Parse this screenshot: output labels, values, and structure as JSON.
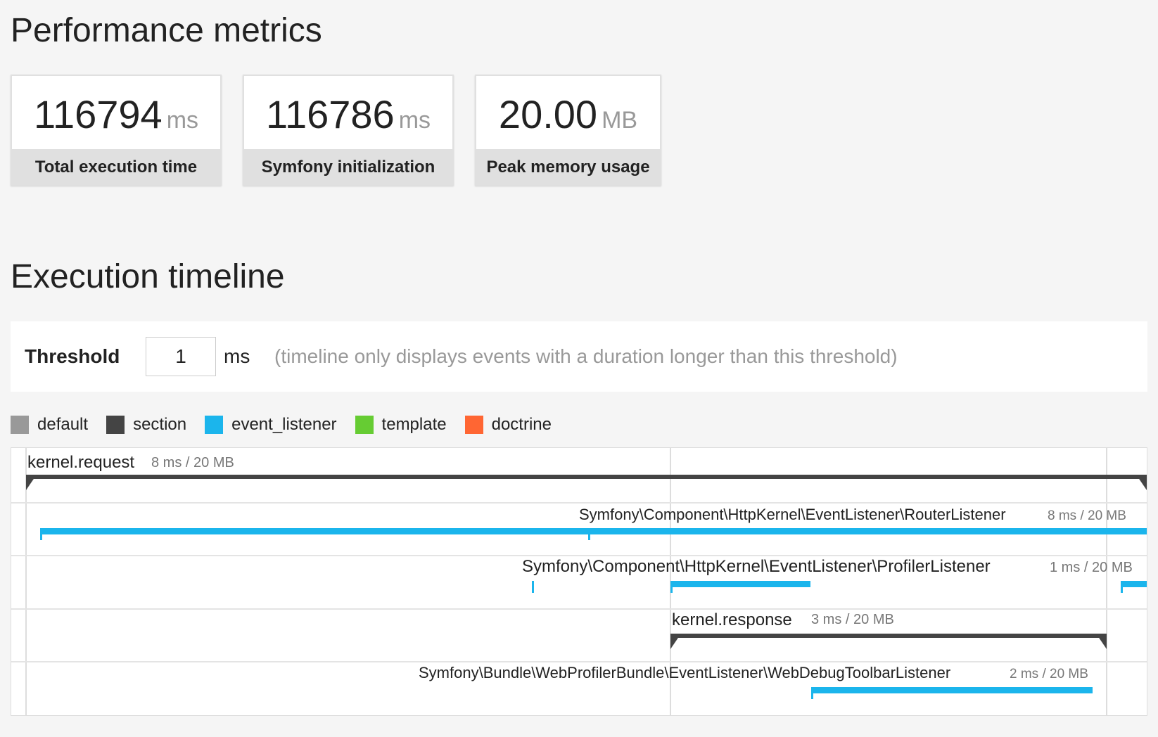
{
  "headings": {
    "performance": "Performance metrics",
    "execution": "Execution timeline"
  },
  "metrics": [
    {
      "value": "116794",
      "unit": "ms",
      "label": "Total execution time"
    },
    {
      "value": "116786",
      "unit": "ms",
      "label": "Symfony initialization"
    },
    {
      "value": "20.00",
      "unit": "MB",
      "label": "Peak memory usage"
    }
  ],
  "threshold": {
    "label": "Threshold",
    "value": "1",
    "unit": "ms",
    "help": "(timeline only displays events with a duration longer than this threshold)"
  },
  "legend": [
    {
      "label": "default",
      "color": "#999999"
    },
    {
      "label": "section",
      "color": "#444444"
    },
    {
      "label": "event_listener",
      "color": "#1bb5ec"
    },
    {
      "label": "template",
      "color": "#66cc33"
    },
    {
      "label": "doctrine",
      "color": "#ff6633"
    }
  ],
  "timeline": {
    "events": [
      {
        "name": "kernel.request",
        "info": "8 ms / 20 MB",
        "category": "section"
      },
      {
        "name": "Symfony\\Component\\HttpKernel\\EventListener\\RouterListener",
        "info": "8 ms / 20 MB",
        "category": "event_listener"
      },
      {
        "name": "Symfony\\Component\\HttpKernel\\EventListener\\ProfilerListener",
        "info": "1 ms / 20 MB",
        "category": "event_listener"
      },
      {
        "name": "kernel.response",
        "info": "3 ms / 20 MB",
        "category": "section"
      },
      {
        "name": "Symfony\\Bundle\\WebProfilerBundle\\EventListener\\WebDebugToolbarListener",
        "info": "2 ms / 20 MB",
        "category": "event_listener"
      }
    ]
  }
}
